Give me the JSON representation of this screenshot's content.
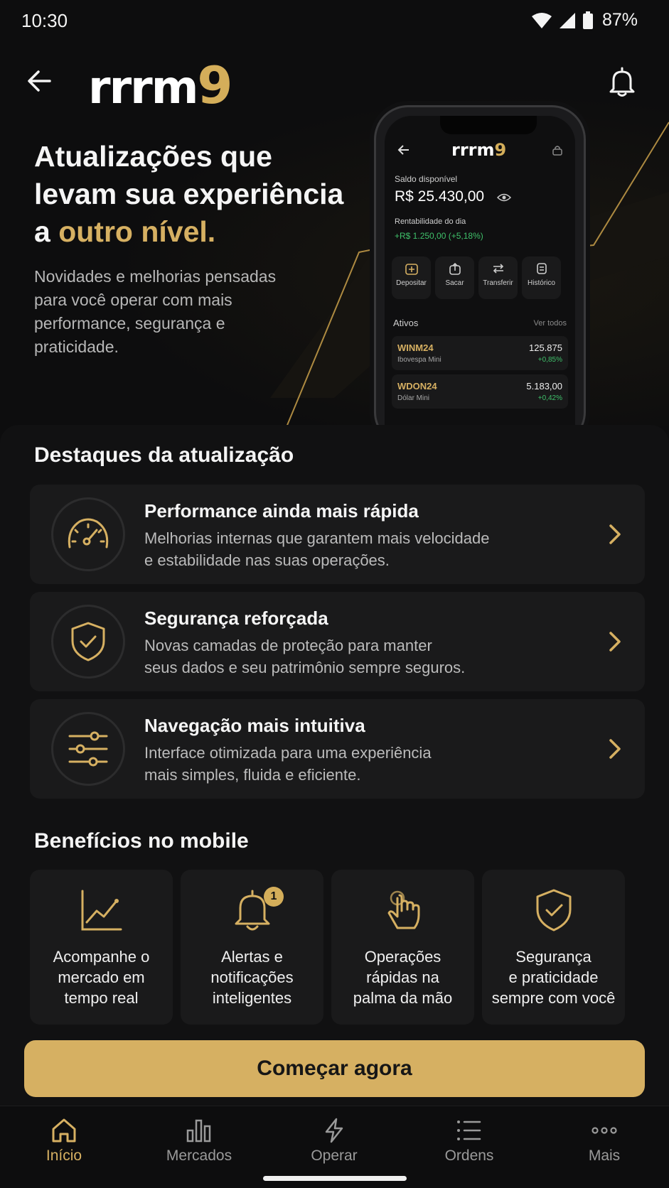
{
  "status": {
    "time": "10:30",
    "battery": "87%"
  },
  "header": {
    "logo_text": "rrrm",
    "logo_accent": "9"
  },
  "hero": {
    "title_line1": "Atualizações que",
    "title_line2": "levam sua experiência",
    "title_line3_prefix": "a ",
    "title_line3_highlight": "outro nível.",
    "subtitle": "Novidades e melhorias pensadas para você operar com mais performance, segurança e praticidade."
  },
  "phone": {
    "logo_text": "rrrm",
    "logo_accent": "9",
    "balance_label": "Saldo disponível",
    "balance": "R$ 25.430,00",
    "profit_label": "Rentabilidade do dia",
    "profit": "+R$ 1.250,00 (+5,18%)",
    "actions": [
      "Depositar",
      "Sacar",
      "Transferir",
      "Histórico"
    ],
    "assets_label": "Ativos",
    "see_all": "Ver todos",
    "assets": [
      {
        "ticker": "WINM24",
        "name": "Ibovespa Mini",
        "price": "125.875",
        "change": "+0,85%"
      },
      {
        "ticker": "WDON24",
        "name": "Dólar Mini",
        "price": "5.183,00",
        "change": "+0,42%"
      }
    ]
  },
  "highlights": {
    "title": "Destaques da atualização",
    "items": [
      {
        "icon": "speedometer-icon",
        "title": "Performance ainda mais rápida",
        "line1": "Melhorias internas que garantem mais velocidade",
        "line2": "e estabilidade nas suas operações."
      },
      {
        "icon": "shield-check-icon",
        "title": "Segurança reforçada",
        "line1": "Novas camadas de proteção para manter",
        "line2": "seus dados e seu patrimônio sempre seguros."
      },
      {
        "icon": "sliders-icon",
        "title": "Navegação mais intuitiva",
        "line1": "Interface otimizada para uma experiência",
        "line2": "mais simples, fluida e eficiente."
      }
    ]
  },
  "benefits": {
    "title": "Benefícios no mobile",
    "badge_count": "1",
    "items": [
      {
        "icon": "chart-icon",
        "lines": [
          "Acompanhe o",
          "mercado em",
          "tempo real"
        ]
      },
      {
        "icon": "bell-icon",
        "lines": [
          "Alertas e",
          "notificações",
          "inteligentes"
        ]
      },
      {
        "icon": "touch-icon",
        "lines": [
          "Operações",
          "rápidas na",
          "palma da mão"
        ]
      },
      {
        "icon": "shield-check-icon",
        "lines": [
          "Segurança",
          "e praticidade",
          "sempre com você"
        ]
      }
    ]
  },
  "cta": {
    "label": "Começar agora"
  },
  "nav": {
    "items": [
      {
        "label": "Início",
        "icon": "home-icon",
        "active": true
      },
      {
        "label": "Mercados",
        "icon": "bar-chart-icon",
        "active": false
      },
      {
        "label": "Operar",
        "icon": "lightning-icon",
        "active": false
      },
      {
        "label": "Ordens",
        "icon": "list-icon",
        "active": false
      },
      {
        "label": "Mais",
        "icon": "more-icon",
        "active": false
      }
    ]
  },
  "colors": {
    "accent": "#d6b062",
    "background": "#0d0d0e",
    "card": "#1a1a1b",
    "positive": "#3fc06a"
  }
}
